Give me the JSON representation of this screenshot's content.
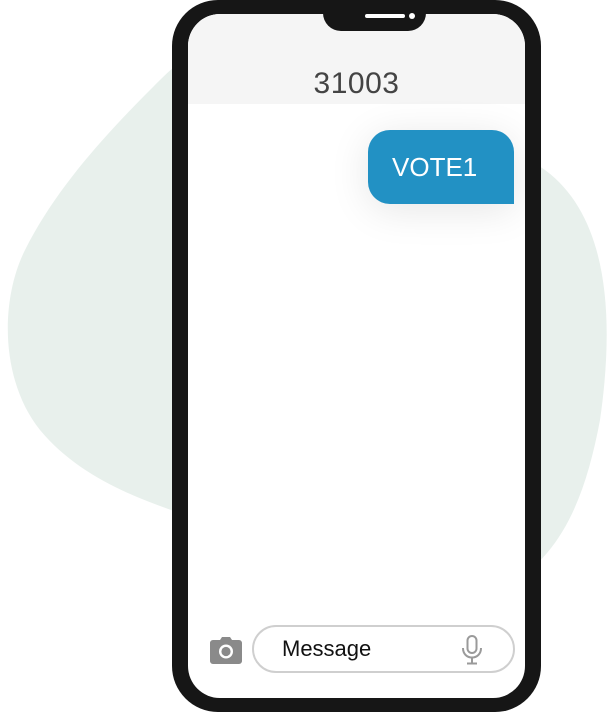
{
  "conversation": {
    "contact": "31003"
  },
  "messages": [
    {
      "direction": "sent",
      "text": "VOTE1"
    }
  ],
  "composer": {
    "placeholder": "Message"
  },
  "icons": {
    "camera": "camera-icon",
    "microphone": "microphone-icon"
  },
  "colors": {
    "sent_bubble": "#2291c4",
    "phone_frame": "#161616",
    "background_blob": "#e8f0ec",
    "header_bg": "#f5f5f5"
  }
}
